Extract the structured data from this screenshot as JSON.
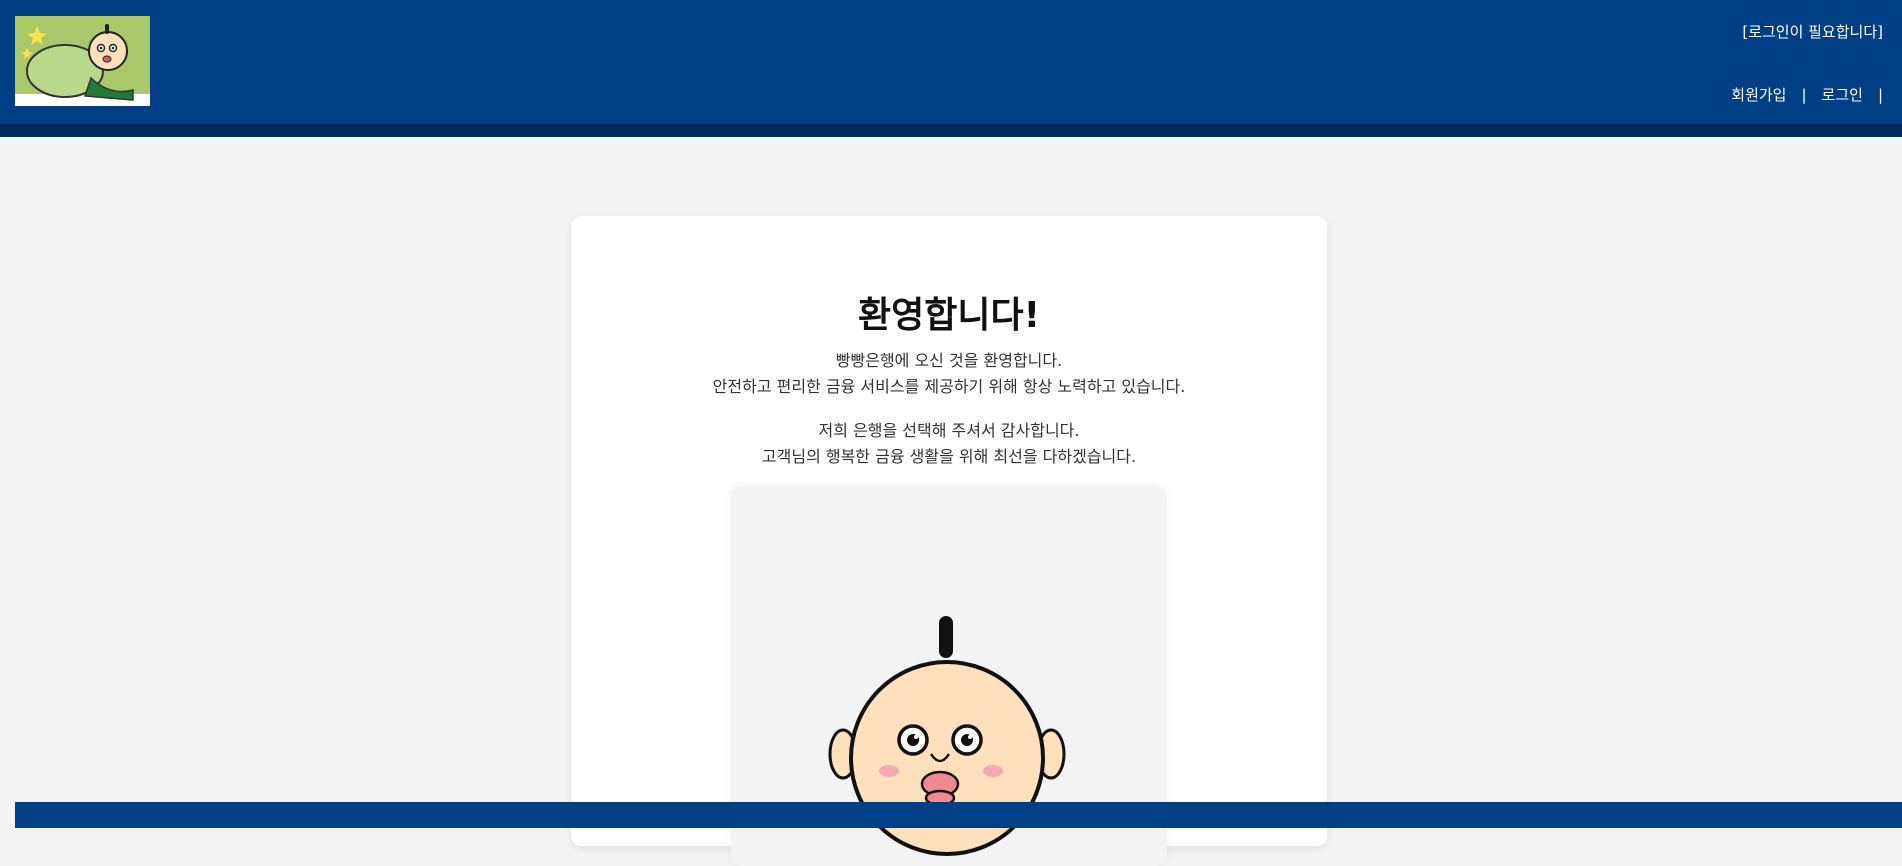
{
  "header": {
    "login_required": "[로그인이 필요합니다]",
    "nav": {
      "signup": "회원가입",
      "login": "로그인",
      "separator": "|"
    }
  },
  "main": {
    "title": "환영합니다!",
    "paragraph1": {
      "line1": "빵빵은행에 오신 것을 환영합니다.",
      "line2": "안전하고 편리한 금융 서비스를 제공하기 위해 항상 노력하고 있습니다."
    },
    "paragraph2": {
      "line1": "저희 은행을 선택해 주셔서 감사합니다.",
      "line2": "고객님의 행복한 금융 생활을 위해 최선을 다하겠습니다."
    }
  },
  "colors": {
    "header_bg": "#003f86",
    "header_strip": "#002a57",
    "page_bg": "#f3f3f3"
  }
}
